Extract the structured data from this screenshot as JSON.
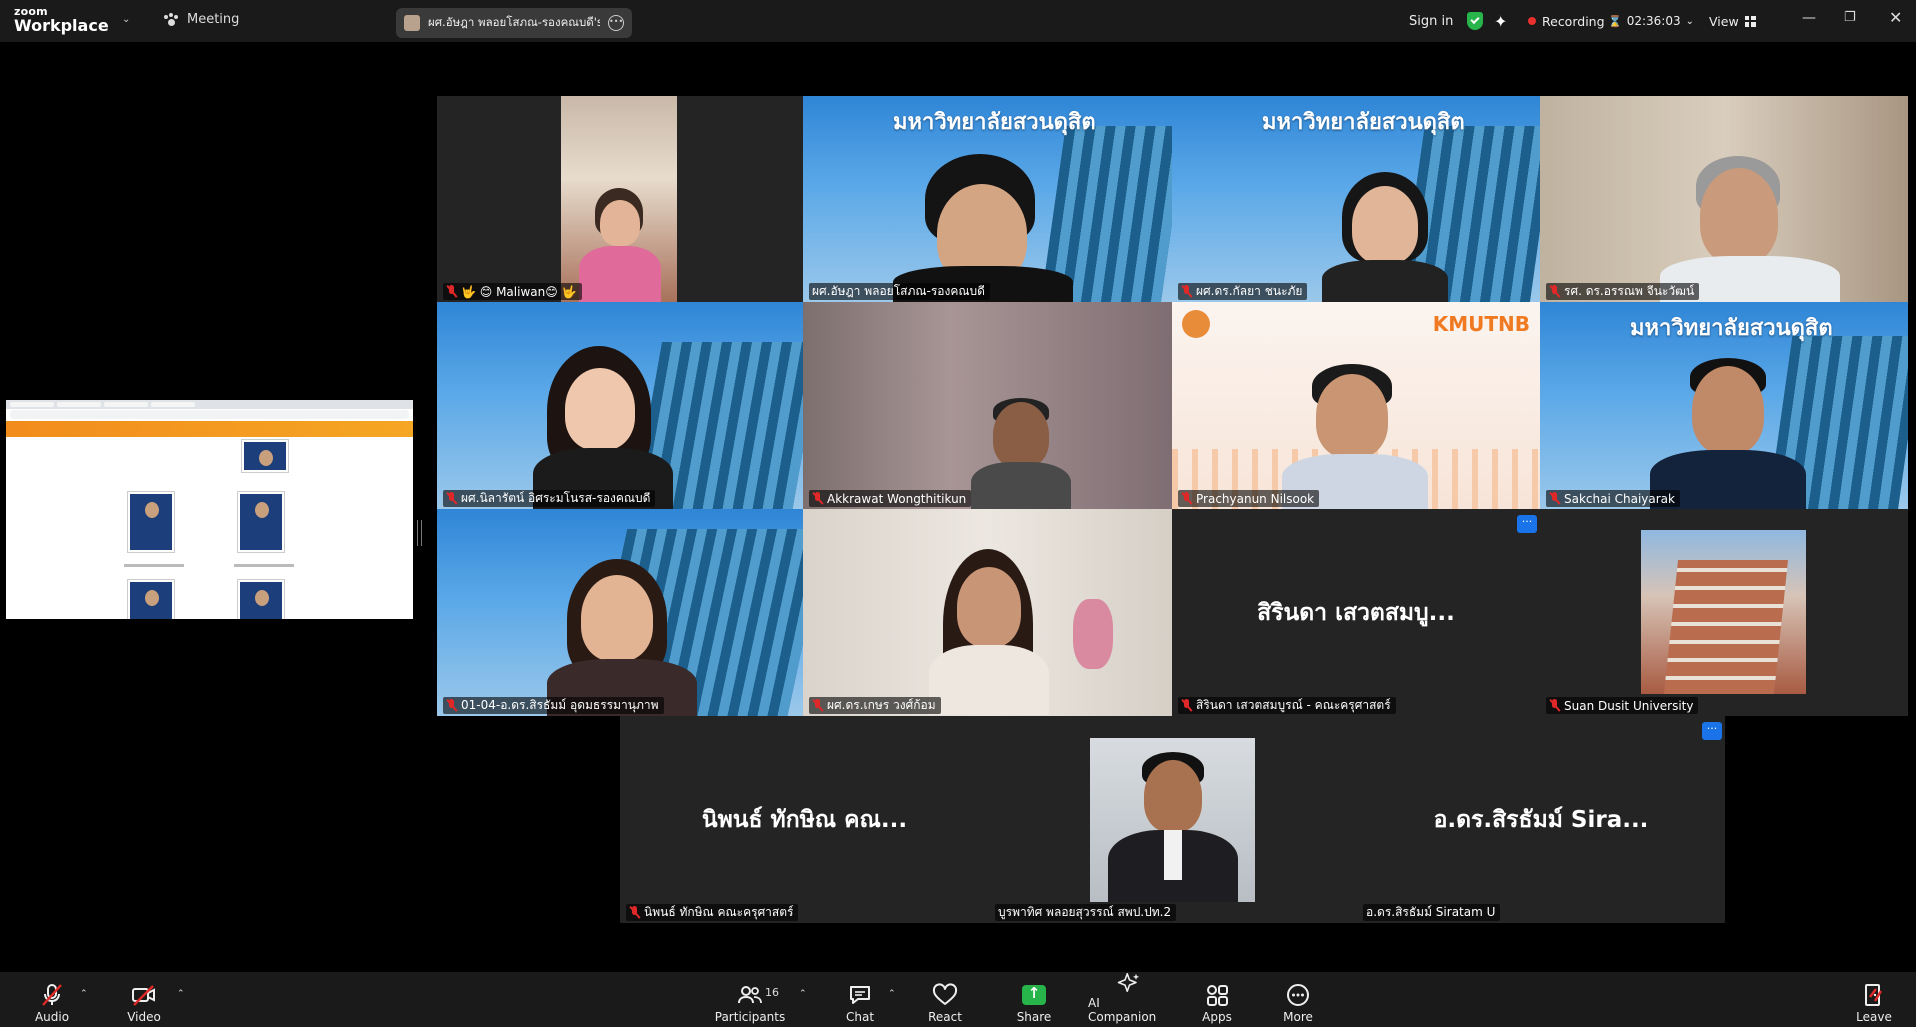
{
  "app": {
    "logo_top": "zoom",
    "logo_bottom": "Workplace",
    "meeting_label": "Meeting"
  },
  "share_pill": {
    "name": "ผศ.อัษฎา พลอยโสภณ-รองคณบดี's sc"
  },
  "topbar": {
    "sign_in": "Sign in",
    "recording": "Recording",
    "timer": "02:36:03",
    "view": "View"
  },
  "colors": {
    "accent_green": "#27b44a",
    "active_speaker": "#2ecc71",
    "mic_muted": "#e02828",
    "recording_dot": "#e8312f",
    "menu_blue": "#1a73e8"
  },
  "participants": [
    {
      "name": "🤟 😊 Maliwan😊 🤟",
      "muted": true
    },
    {
      "name": "ผศ.อัษฎา พลอยโสภณ-รองคณบดี",
      "muted": false,
      "active": true,
      "background_text": "มหาวิทยาลัยสวนดุสิต"
    },
    {
      "name": "ผศ.ดร.กัลยา ชนะภัย",
      "muted": true,
      "background_text": "มหาวิทยาลัยสวนดุสิต"
    },
    {
      "name": "รศ. ดร.อรรณพ จีนะวัฒน์",
      "muted": true
    },
    {
      "name": "ผศ.นิลารัตน์ อิศระมโนรส-รองคณบดี",
      "muted": true
    },
    {
      "name": "Akkrawat Wongthitikun",
      "muted": true
    },
    {
      "name": "Prachyanun Nilsook",
      "muted": true,
      "background_text": "KMUTNB"
    },
    {
      "name": "Sakchai Chaiyarak",
      "muted": true,
      "background_text": "มหาวิทยาลัยสวนดุสิต"
    },
    {
      "name": "01-04-อ.ดร.สิรธัมม์ อุดมธรรมานุภาพ",
      "muted": true
    },
    {
      "name": "ผศ.ดร.เกษร วงศ์ก้อม",
      "muted": true
    },
    {
      "name": "สิรินดา เสวตสมบูรณ์ - คณะครุศาสตร์",
      "muted": true,
      "display_name": "สิรินดา เสวตสมบู..."
    },
    {
      "name": "Suan Dusit University",
      "muted": true
    },
    {
      "name": "นิพนธ์ ทักษิณ คณะครุศาสตร์",
      "muted": true,
      "display_name": "นิพนธ์ ทักษิณ คณ..."
    },
    {
      "name": "บูรพาทิศ พลอยสุวรรณ์ สพป.ปท.2",
      "muted": false
    },
    {
      "name": "อ.ดร.สิรธัมม์ Siratam U",
      "muted": false,
      "display_name": "อ.ดร.สิรธัมม์ Sira..."
    }
  ],
  "toolbar": {
    "audio": "Audio",
    "video": "Video",
    "participants": "Participants",
    "participants_count": "16",
    "chat": "Chat",
    "react": "React",
    "share": "Share",
    "ai_companion": "AI Companion",
    "apps": "Apps",
    "more": "More",
    "leave": "Leave"
  },
  "icons": [
    "paw-icon",
    "chevron-down-icon",
    "shield-check-icon",
    "sparkle-icon",
    "record-dot-icon",
    "hourglass-icon",
    "grid-view-icon",
    "minimize-icon",
    "restore-icon",
    "close-icon",
    "mic-muted-icon",
    "video-off-icon",
    "participants-icon",
    "chat-icon",
    "heart-icon",
    "share-screen-icon",
    "ai-sparkle-icon",
    "apps-icon",
    "more-icon",
    "leave-icon"
  ]
}
